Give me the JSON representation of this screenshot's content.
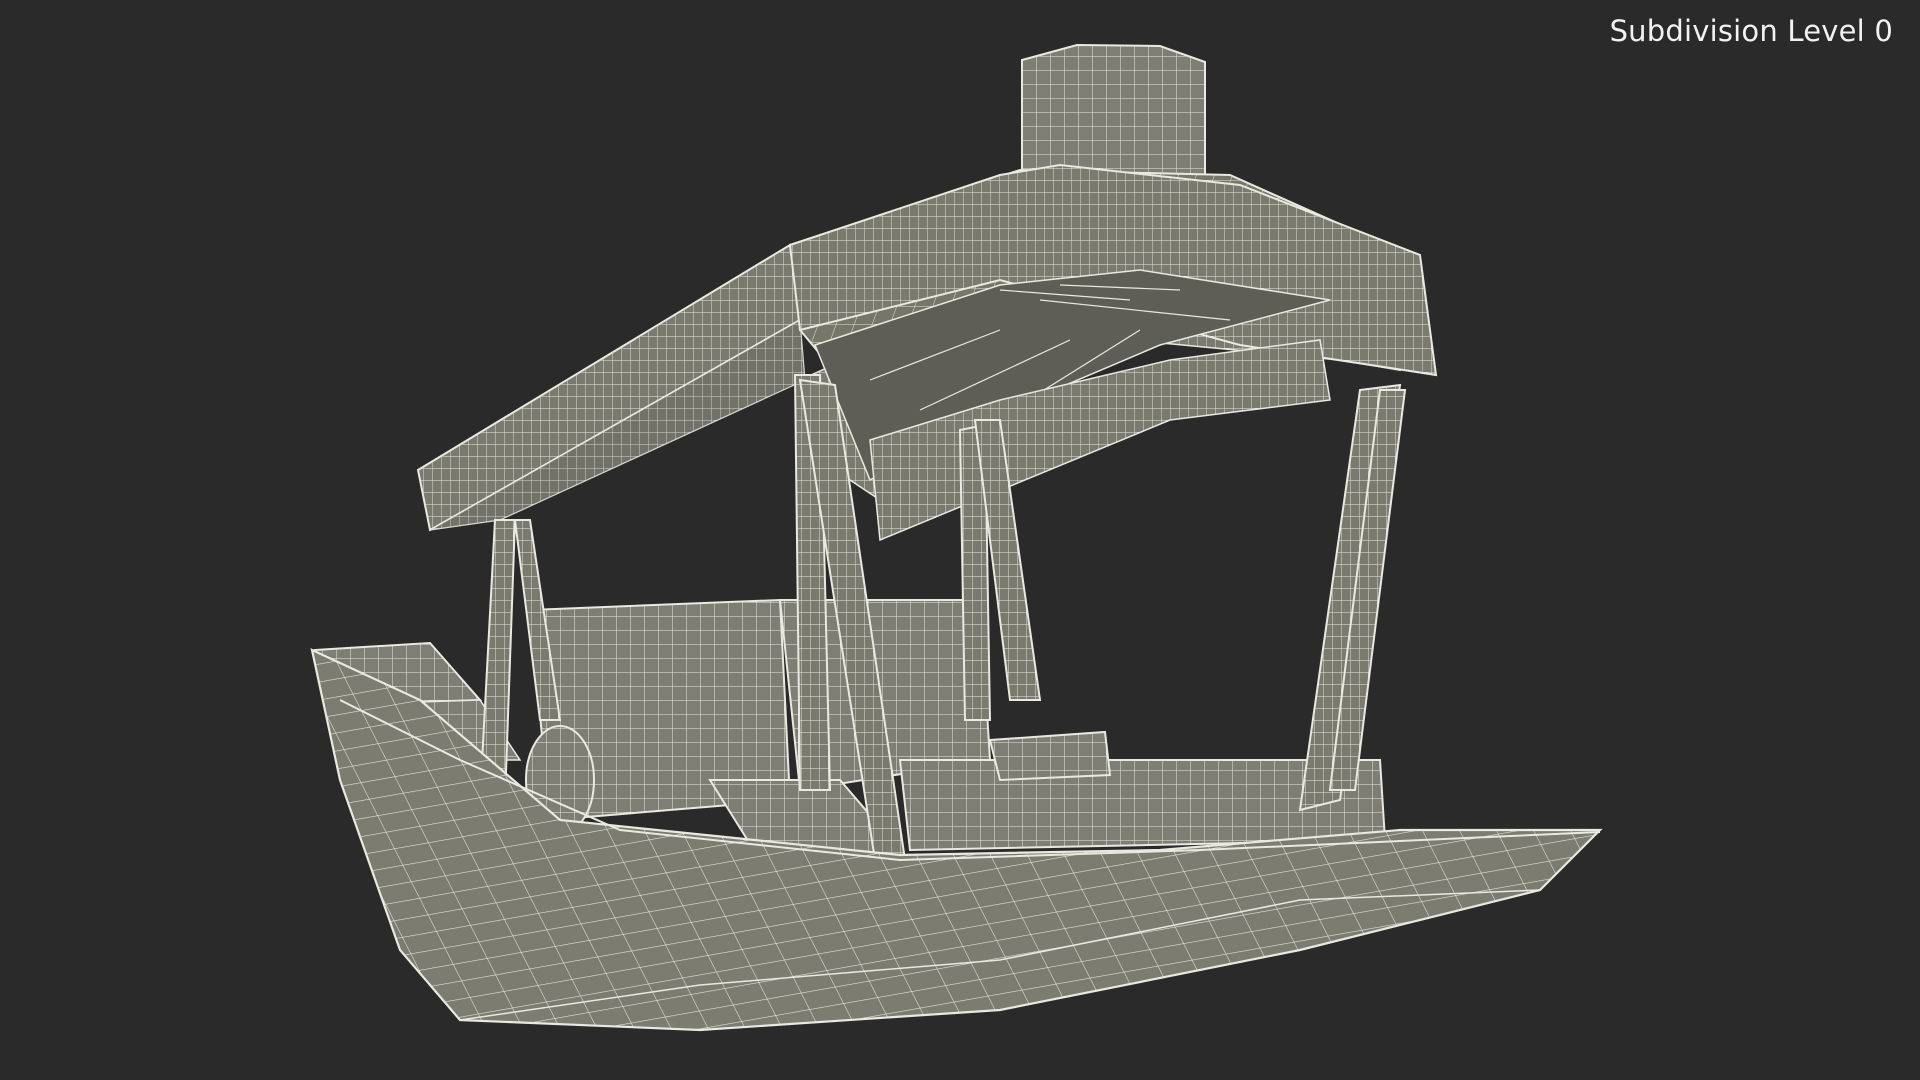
{
  "viewport": {
    "subdivision_label": "Subdivision Level 0",
    "background": "#2a2a2a"
  },
  "model": {
    "icon": "shikara-boat-wireframe-icon",
    "mesh_fill": "#7e7e74",
    "mesh_fill_dark": "#6d6d64",
    "wire_color": "#e9e9e1"
  }
}
